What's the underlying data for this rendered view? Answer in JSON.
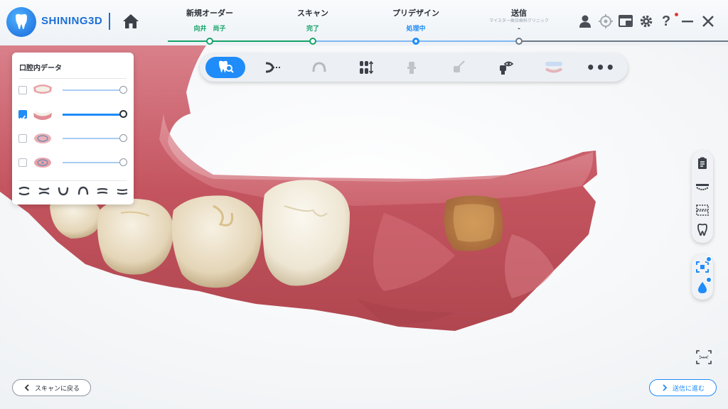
{
  "brand": {
    "name": "SHINING3D"
  },
  "steps": [
    {
      "title": "新規オーダー",
      "sub": "向井　尚子",
      "status": "done"
    },
    {
      "title": "スキャン",
      "sub": "完了",
      "status": "done"
    },
    {
      "title": "プリデザイン",
      "sub": "処理中",
      "status": "active"
    },
    {
      "title": "送信",
      "sub": "-",
      "sub_top": "マイスター歯日歯科クリニック",
      "status": "pending"
    }
  ],
  "colors": {
    "accent": "#1f8cf9",
    "done": "#16a36a",
    "active": "#1f8cf9",
    "gum": "#c9545a",
    "tooth": "#efe6d6"
  },
  "header_icons": [
    "user-icon",
    "target-icon",
    "screenshot-icon",
    "gear-icon",
    "help-icon",
    "minimize-icon",
    "close-icon"
  ],
  "toolbar": {
    "tools": [
      "tooth-scan-tool",
      "margin-line-tool",
      "arch-tool",
      "tooth-align-tool",
      "implant-tool",
      "brush-tool",
      "visibility-tool",
      "model-tool",
      "more-tool"
    ],
    "active_index": 0
  },
  "panel": {
    "title": "口腔内データ",
    "layers": [
      {
        "name": "upper-jaw-layer",
        "checked": false,
        "opacity": 1.0
      },
      {
        "name": "lower-jaw-layer",
        "checked": true,
        "opacity": 1.0
      },
      {
        "name": "upper-prep-layer",
        "checked": false,
        "opacity": 1.0
      },
      {
        "name": "lower-prep-layer",
        "checked": false,
        "opacity": 1.0
      }
    ],
    "views": [
      "front-view-icon",
      "bite-view-icon",
      "lower-view-icon",
      "upper-view-icon",
      "left-view-icon",
      "right-view-icon"
    ]
  },
  "right_tools": [
    "order-info-icon",
    "jaw-view-icon",
    "jaw-compare-icon",
    "tooth-icon",
    "auto-align-icon",
    "color-drop-icon",
    "screen-fit-icon"
  ],
  "footer": {
    "back_label": "スキャンに戻る",
    "next_label": "送信に進む"
  }
}
